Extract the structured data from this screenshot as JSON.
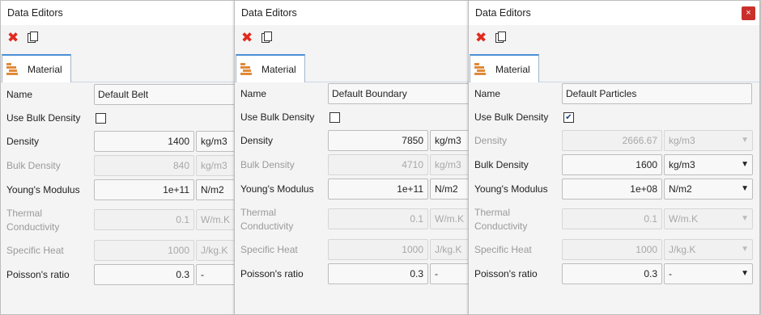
{
  "panels": [
    {
      "title": "Data Editors",
      "tab": "Material",
      "name_label": "Name",
      "name_value": "Default Belt",
      "use_bulk_label": "Use Bulk Density",
      "use_bulk_checked": false,
      "has_close": false,
      "rows": [
        {
          "label": "Density",
          "value": "1400",
          "unit": "kg/m3",
          "enabled": true
        },
        {
          "label": "Bulk Density",
          "value": "840",
          "unit": "kg/m3",
          "enabled": false
        },
        {
          "label": "Young's Modulus",
          "value": "1e+11",
          "unit": "N/m2",
          "enabled": true
        },
        {
          "label_lines": [
            "Thermal",
            "Conductivity"
          ],
          "value": "0.1",
          "unit": "W/m.K",
          "enabled": false
        },
        {
          "label": "Specific Heat",
          "value": "1000",
          "unit": "J/kg.K",
          "enabled": false
        },
        {
          "label": "Poisson's ratio",
          "value": "0.3",
          "unit": "-",
          "enabled": true
        }
      ]
    },
    {
      "title": "Data Editors",
      "tab": "Material",
      "name_label": "Name",
      "name_value": "Default Boundary",
      "use_bulk_label": "Use Bulk Density",
      "use_bulk_checked": false,
      "has_close": false,
      "rows": [
        {
          "label": "Density",
          "value": "7850",
          "unit": "kg/m3",
          "enabled": true
        },
        {
          "label": "Bulk Density",
          "value": "4710",
          "unit": "kg/m3",
          "enabled": false
        },
        {
          "label": "Young's Modulus",
          "value": "1e+11",
          "unit": "N/m2",
          "enabled": true
        },
        {
          "label_lines": [
            "Thermal",
            "Conductivity"
          ],
          "value": "0.1",
          "unit": "W/m.K",
          "enabled": false
        },
        {
          "label": "Specific Heat",
          "value": "1000",
          "unit": "J/kg.K",
          "enabled": false
        },
        {
          "label": "Poisson's ratio",
          "value": "0.3",
          "unit": "-",
          "enabled": true
        }
      ]
    },
    {
      "title": "Data Editors",
      "tab": "Material",
      "name_label": "Name",
      "name_value": "Default Particles",
      "use_bulk_label": "Use Bulk Density",
      "use_bulk_checked": true,
      "has_close": true,
      "close_glyph": "×",
      "rows": [
        {
          "label": "Density",
          "value": "2666.67",
          "unit": "kg/m3",
          "enabled": false
        },
        {
          "label": "Bulk Density",
          "value": "1600",
          "unit": "kg/m3",
          "enabled": true
        },
        {
          "label": "Young's Modulus",
          "value": "1e+08",
          "unit": "N/m2",
          "enabled": true
        },
        {
          "label_lines": [
            "Thermal",
            "Conductivity"
          ],
          "value": "0.1",
          "unit": "W/m.K",
          "enabled": false
        },
        {
          "label": "Specific Heat",
          "value": "1000",
          "unit": "J/kg.K",
          "enabled": false
        },
        {
          "label": "Poisson's ratio",
          "value": "0.3",
          "unit": "-",
          "enabled": true
        }
      ]
    }
  ],
  "icons": {
    "delete": "delete-icon",
    "copy": "copy-icon",
    "material": "material-icon",
    "dropdown": "chevron-down-icon"
  },
  "colors": {
    "delete_red": "#e02b20",
    "tab_accent": "#4a8fd6",
    "close_red": "#c9302c",
    "material_icon": "#e08a3a"
  }
}
